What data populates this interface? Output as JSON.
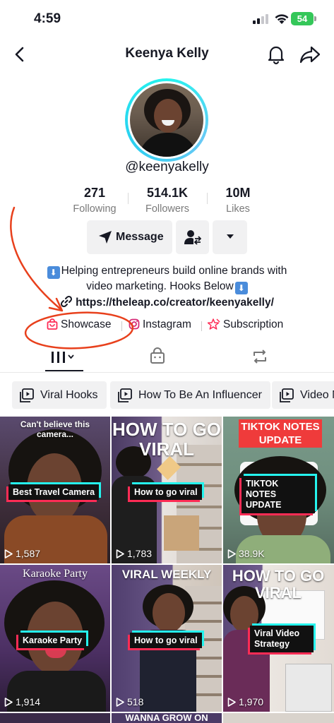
{
  "status_bar": {
    "time": "4:59",
    "battery": "54"
  },
  "header": {
    "title": "Keenya Kelly"
  },
  "profile": {
    "username": "@keenyakelly",
    "stats": [
      {
        "value": "271",
        "label": "Following"
      },
      {
        "value": "514.1K",
        "label": "Followers"
      },
      {
        "value": "10M",
        "label": "Likes"
      }
    ],
    "message_label": "Message",
    "bio_line1": "Helping entrepreneurs build online brands with",
    "bio_line2": "video marketing. Hooks Below",
    "bio_emoji": "⬇",
    "link": "https://theleap.co/creator/keenyakelly/"
  },
  "quick_links": [
    {
      "label": "Showcase",
      "icon": "shopping-bag-icon"
    },
    {
      "label": "Instagram",
      "icon": "instagram-icon"
    },
    {
      "label": "Subscription",
      "icon": "subscription-icon"
    }
  ],
  "tabs": [
    {
      "icon": "videos-grid-icon",
      "active": true
    },
    {
      "icon": "shop-bag-icon",
      "active": false
    },
    {
      "icon": "repost-icon",
      "active": false
    }
  ],
  "playlists": [
    {
      "label": "Viral Hooks"
    },
    {
      "label": "How To Be An Influencer"
    },
    {
      "label": "Video M"
    }
  ],
  "videos": [
    {
      "top_text": "Can't believe this camera...",
      "caption": "Best Travel Camera",
      "views": "1,587"
    },
    {
      "top_text": "HOW TO GO VIRAL",
      "caption": "How to go viral",
      "views": "1,783"
    },
    {
      "top_text": "TIKTOK NOTES UPDATE",
      "caption": "TIKTOK NOTES UPDATE",
      "views": "38.9K"
    },
    {
      "top_text": "Karaoke Party",
      "caption": "Karaoke Party",
      "views": "1,914"
    },
    {
      "top_text": "VIRAL WEEKLY",
      "caption": "How to go viral",
      "views": "518"
    },
    {
      "top_text": "HOW TO GO VIRAL",
      "caption": "Viral Video Strategy",
      "views": "1,970"
    }
  ],
  "partial_row_text": "WANNA GROW ON",
  "colors": {
    "accent_red": "#fe2c55",
    "accent_cyan": "#25f4ee",
    "annotation": "#e8401c"
  }
}
